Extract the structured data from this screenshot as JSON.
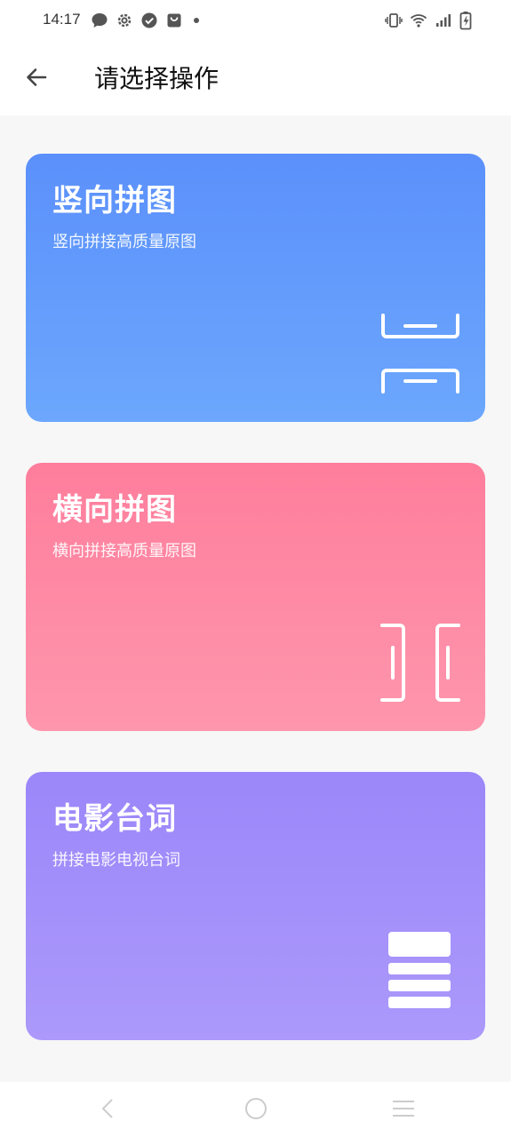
{
  "status_bar": {
    "time": "14:17",
    "left_icons": [
      "chat-bubble-icon",
      "settings-gear-icon",
      "check-circle-icon",
      "shopping-bag-icon",
      "dot-icon"
    ],
    "right_icons": [
      "vibrate-icon",
      "wifi-icon",
      "cellular-signal-icon",
      "battery-charging-icon"
    ]
  },
  "app_bar": {
    "back_icon": "arrow-left-icon",
    "title": "请选择操作"
  },
  "cards": [
    {
      "title": "竖向拼图",
      "description": "竖向拼接高质量原图",
      "icon": "vertical-stitch-icon",
      "colors": [
        "#5b90fb",
        "#6ca7fd"
      ]
    },
    {
      "title": "横向拼图",
      "description": "横向拼接高质量原图",
      "icon": "horizontal-stitch-icon",
      "colors": [
        "#fe7e9c",
        "#fe96ad"
      ]
    },
    {
      "title": "电影台词",
      "description": "拼接电影电视台词",
      "icon": "subtitle-stack-icon",
      "colors": [
        "#9b87f9",
        "#ac99fb"
      ]
    }
  ],
  "nav_bar": {
    "items": [
      "nav-back-icon",
      "nav-home-icon",
      "nav-menu-icon"
    ]
  }
}
